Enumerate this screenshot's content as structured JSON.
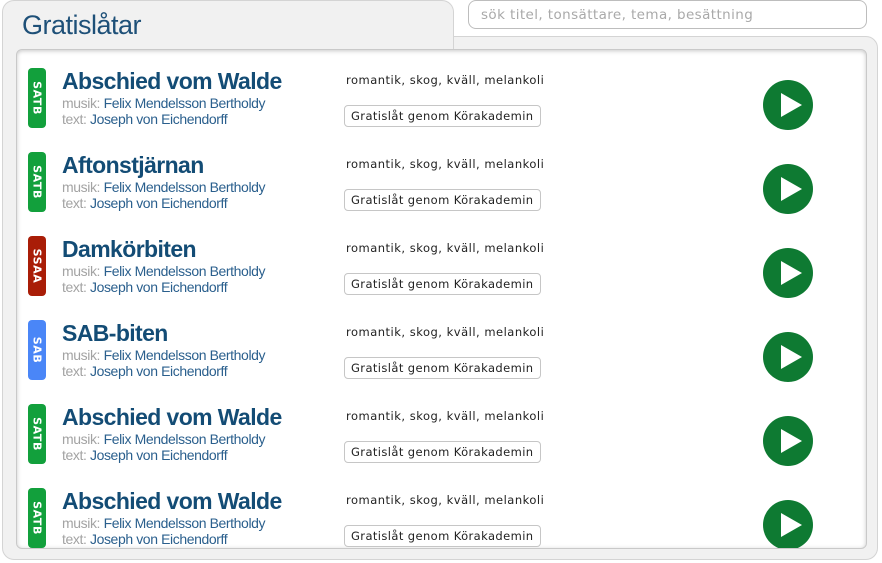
{
  "header": {
    "title": "Gratislåtar"
  },
  "search": {
    "placeholder": "sök titel, tonsättare, tema, besättning",
    "value": ""
  },
  "labels": {
    "music_prefix": "musik:",
    "text_prefix": "text:"
  },
  "colors": {
    "SATB": "#12a03c",
    "SSAA": "#a91d07",
    "SAB": "#4a86f7",
    "play": "#0e7a32",
    "title": "#134c75"
  },
  "songs": [
    {
      "voicing": "SATB",
      "title": "Abschied vom Walde",
      "composer": "Felix Mendelsson Bertholdy",
      "lyricist": "Joseph von Eichendorff",
      "tags": "romantik, skog, kväll, melankoli",
      "source": "Gratislåt genom Körakademin",
      "play_icon": "play-icon"
    },
    {
      "voicing": "SATB",
      "title": "Aftonstjärnan",
      "composer": "Felix Mendelsson Bertholdy",
      "lyricist": "Joseph von Eichendorff",
      "tags": "romantik, skog, kväll, melankoli",
      "source": "Gratislåt genom Körakademin",
      "play_icon": "play-icon"
    },
    {
      "voicing": "SSAA",
      "title": "Damkörbiten",
      "composer": "Felix Mendelsson Bertholdy",
      "lyricist": "Joseph von Eichendorff",
      "tags": "romantik, skog, kväll, melankoli",
      "source": "Gratislåt genom Körakademin",
      "play_icon": "play-icon"
    },
    {
      "voicing": "SAB",
      "title": "SAB-biten",
      "composer": "Felix Mendelsson Bertholdy",
      "lyricist": "Joseph von Eichendorff",
      "tags": "romantik, skog, kväll, melankoli",
      "source": "Gratislåt genom Körakademin",
      "play_icon": "play-icon"
    },
    {
      "voicing": "SATB",
      "title": "Abschied vom Walde",
      "composer": "Felix Mendelsson Bertholdy",
      "lyricist": "Joseph von Eichendorff",
      "tags": "romantik, skog, kväll, melankoli",
      "source": "Gratislåt genom Körakademin",
      "play_icon": "play-icon"
    },
    {
      "voicing": "SATB",
      "title": "Abschied vom Walde",
      "composer": "Felix Mendelsson Bertholdy",
      "lyricist": "Joseph von Eichendorff",
      "tags": "romantik, skog, kväll, melankoli",
      "source": "Gratislåt genom Körakademin",
      "play_icon": "play-icon"
    }
  ]
}
